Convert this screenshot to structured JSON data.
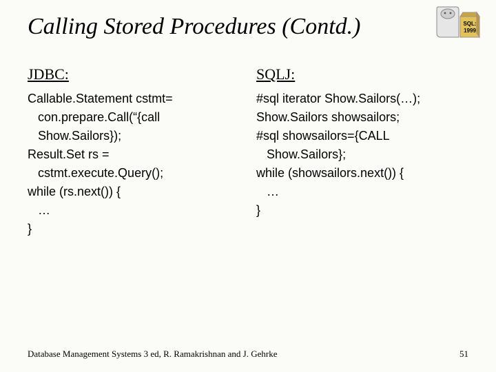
{
  "title": "Calling Stored Procedures (Contd.)",
  "left": {
    "heading": "JDBC:",
    "code": "Callable.Statement cstmt=\n   con.prepare.Call(“{call\n   Show.Sailors});\nResult.Set rs =\n   cstmt.execute.Query();\nwhile (rs.next()) {\n   …\n}"
  },
  "right": {
    "heading": "SQLJ:",
    "code": "#sql iterator Show.Sailors(…);\nShow.Sailors showsailors;\n#sql showsailors={CALL\n   Show.Sailors};\nwhile (showsailors.next()) {\n   …\n}"
  },
  "footer": {
    "credit": "Database Management Systems 3 ed, R. Ramakrishnan and J. Gehrke",
    "page": "51"
  },
  "logo": {
    "label": "SQL: 1999"
  }
}
